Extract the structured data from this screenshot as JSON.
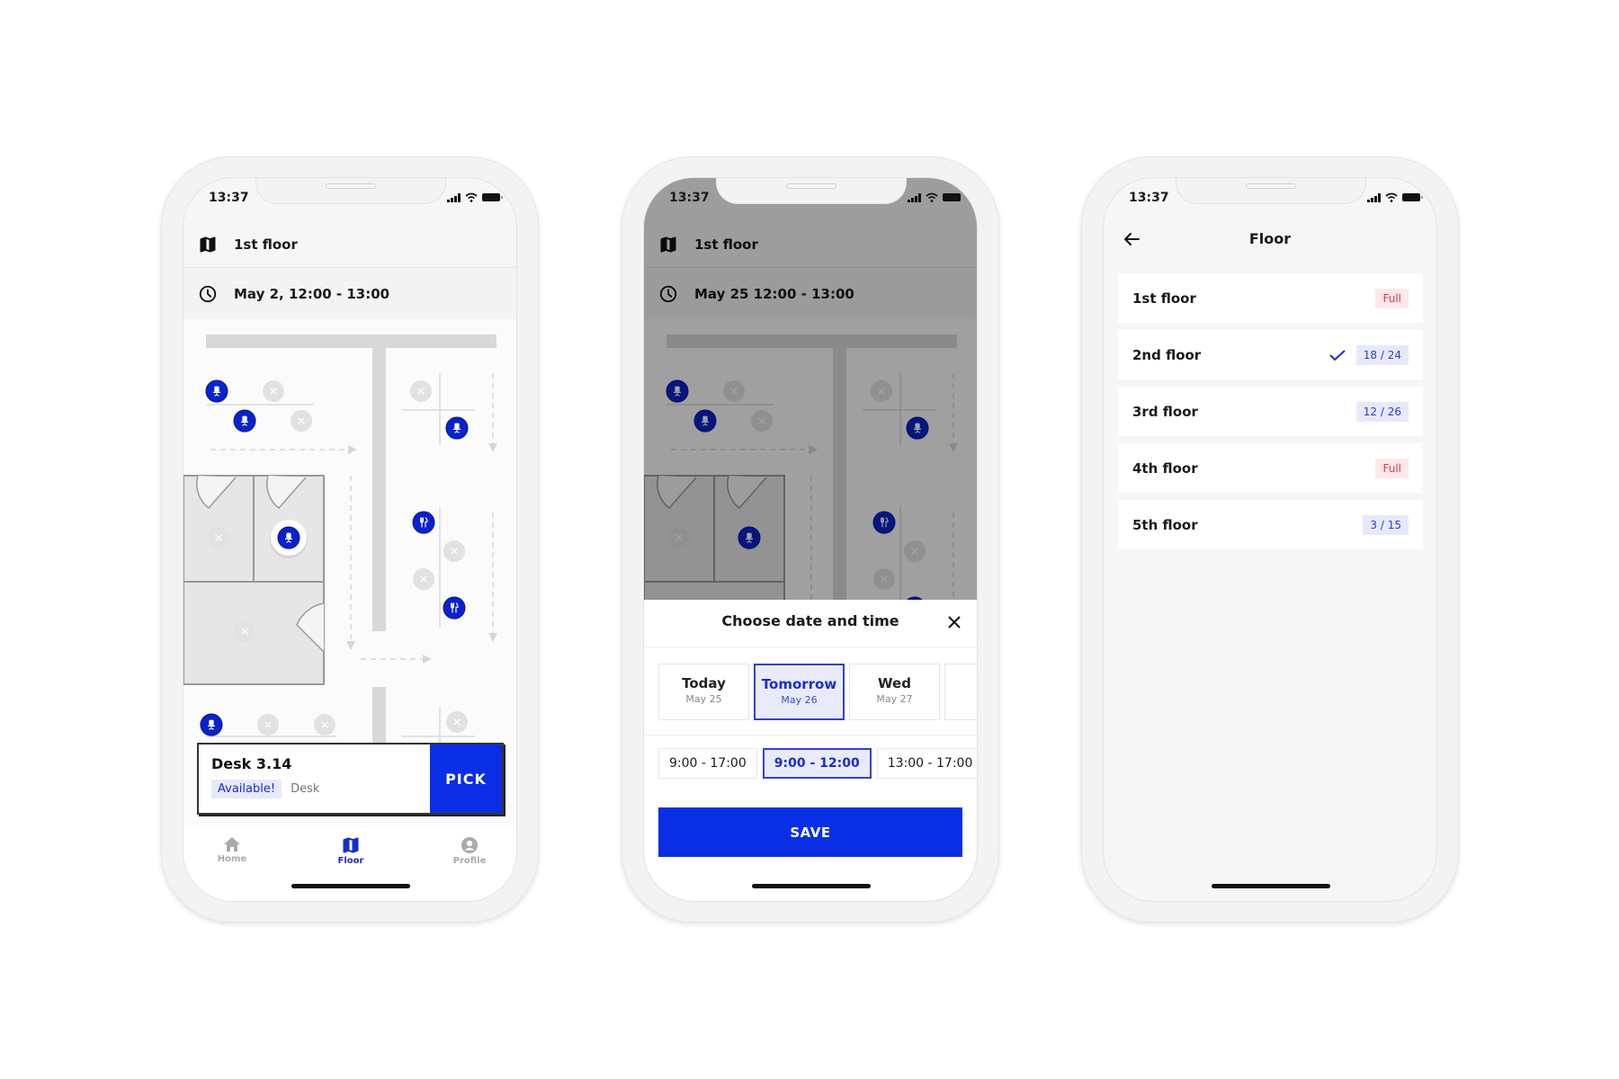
{
  "colors": {
    "accent": "#0a2ee6",
    "accent_text": "#1a2dc9",
    "full_red": "#e03a4e",
    "chip_bg": "#e7e9fb"
  },
  "phones": [
    {
      "status": {
        "time": "13:37"
      },
      "header": {
        "floor_icon": "map-icon",
        "floor": "1st floor",
        "time_icon": "clock-icon",
        "datetime": "May 2, 12:00 - 13:00"
      },
      "desk_card": {
        "title": "Desk 3.14",
        "status": "Available!",
        "type": "Desk",
        "pick_label": "PICK"
      },
      "tabs": [
        {
          "label": "Home",
          "icon": "home-icon",
          "active": false
        },
        {
          "label": "Floor",
          "icon": "map-icon",
          "active": true
        },
        {
          "label": "Profile",
          "icon": "profile-icon",
          "active": false
        }
      ]
    },
    {
      "status": {
        "time": "13:37"
      },
      "header": {
        "floor": "1st floor",
        "datetime": "May 25 12:00 - 13:00"
      },
      "sheet": {
        "title": "Choose date and time",
        "dates": [
          {
            "day": "Today",
            "date": "May 25",
            "selected": false
          },
          {
            "day": "Tomorrow",
            "date": "May 26",
            "selected": true
          },
          {
            "day": "Wed",
            "date": "May 27",
            "selected": false
          }
        ],
        "times": [
          {
            "label": "9:00 - 17:00",
            "selected": false
          },
          {
            "label": "9:00 - 12:00",
            "selected": true
          },
          {
            "label": "13:00 - 17:00",
            "selected": false
          }
        ],
        "save_label": "SAVE"
      }
    },
    {
      "status": {
        "time": "13:37"
      },
      "title": "Floor",
      "floors": [
        {
          "name": "1st floor",
          "badge": "Full",
          "kind": "full",
          "selected": false
        },
        {
          "name": "2nd floor",
          "badge": "18 / 24",
          "kind": "count",
          "selected": true
        },
        {
          "name": "3rd floor",
          "badge": "12 / 26",
          "kind": "count",
          "selected": false
        },
        {
          "name": "4th floor",
          "badge": "Full",
          "kind": "full",
          "selected": false
        },
        {
          "name": "5th floor",
          "badge": "3 / 15",
          "kind": "count",
          "selected": false
        }
      ]
    }
  ],
  "map": {
    "seats": [
      {
        "type": "desk",
        "state": "available"
      },
      {
        "type": "desk",
        "state": "taken"
      },
      {
        "type": "desk",
        "state": "available"
      },
      {
        "type": "desk",
        "state": "taken"
      },
      {
        "type": "desk",
        "state": "taken"
      },
      {
        "type": "desk",
        "state": "available",
        "selected": true
      },
      {
        "type": "desk",
        "state": "taken"
      },
      {
        "type": "desk",
        "state": "taken"
      },
      {
        "type": "desk",
        "state": "available"
      },
      {
        "type": "dining",
        "state": "available"
      },
      {
        "type": "desk",
        "state": "taken"
      },
      {
        "type": "desk",
        "state": "taken"
      },
      {
        "type": "dining",
        "state": "available"
      },
      {
        "type": "desk",
        "state": "available"
      },
      {
        "type": "desk",
        "state": "taken"
      },
      {
        "type": "desk",
        "state": "taken"
      },
      {
        "type": "desk",
        "state": "taken"
      }
    ]
  }
}
